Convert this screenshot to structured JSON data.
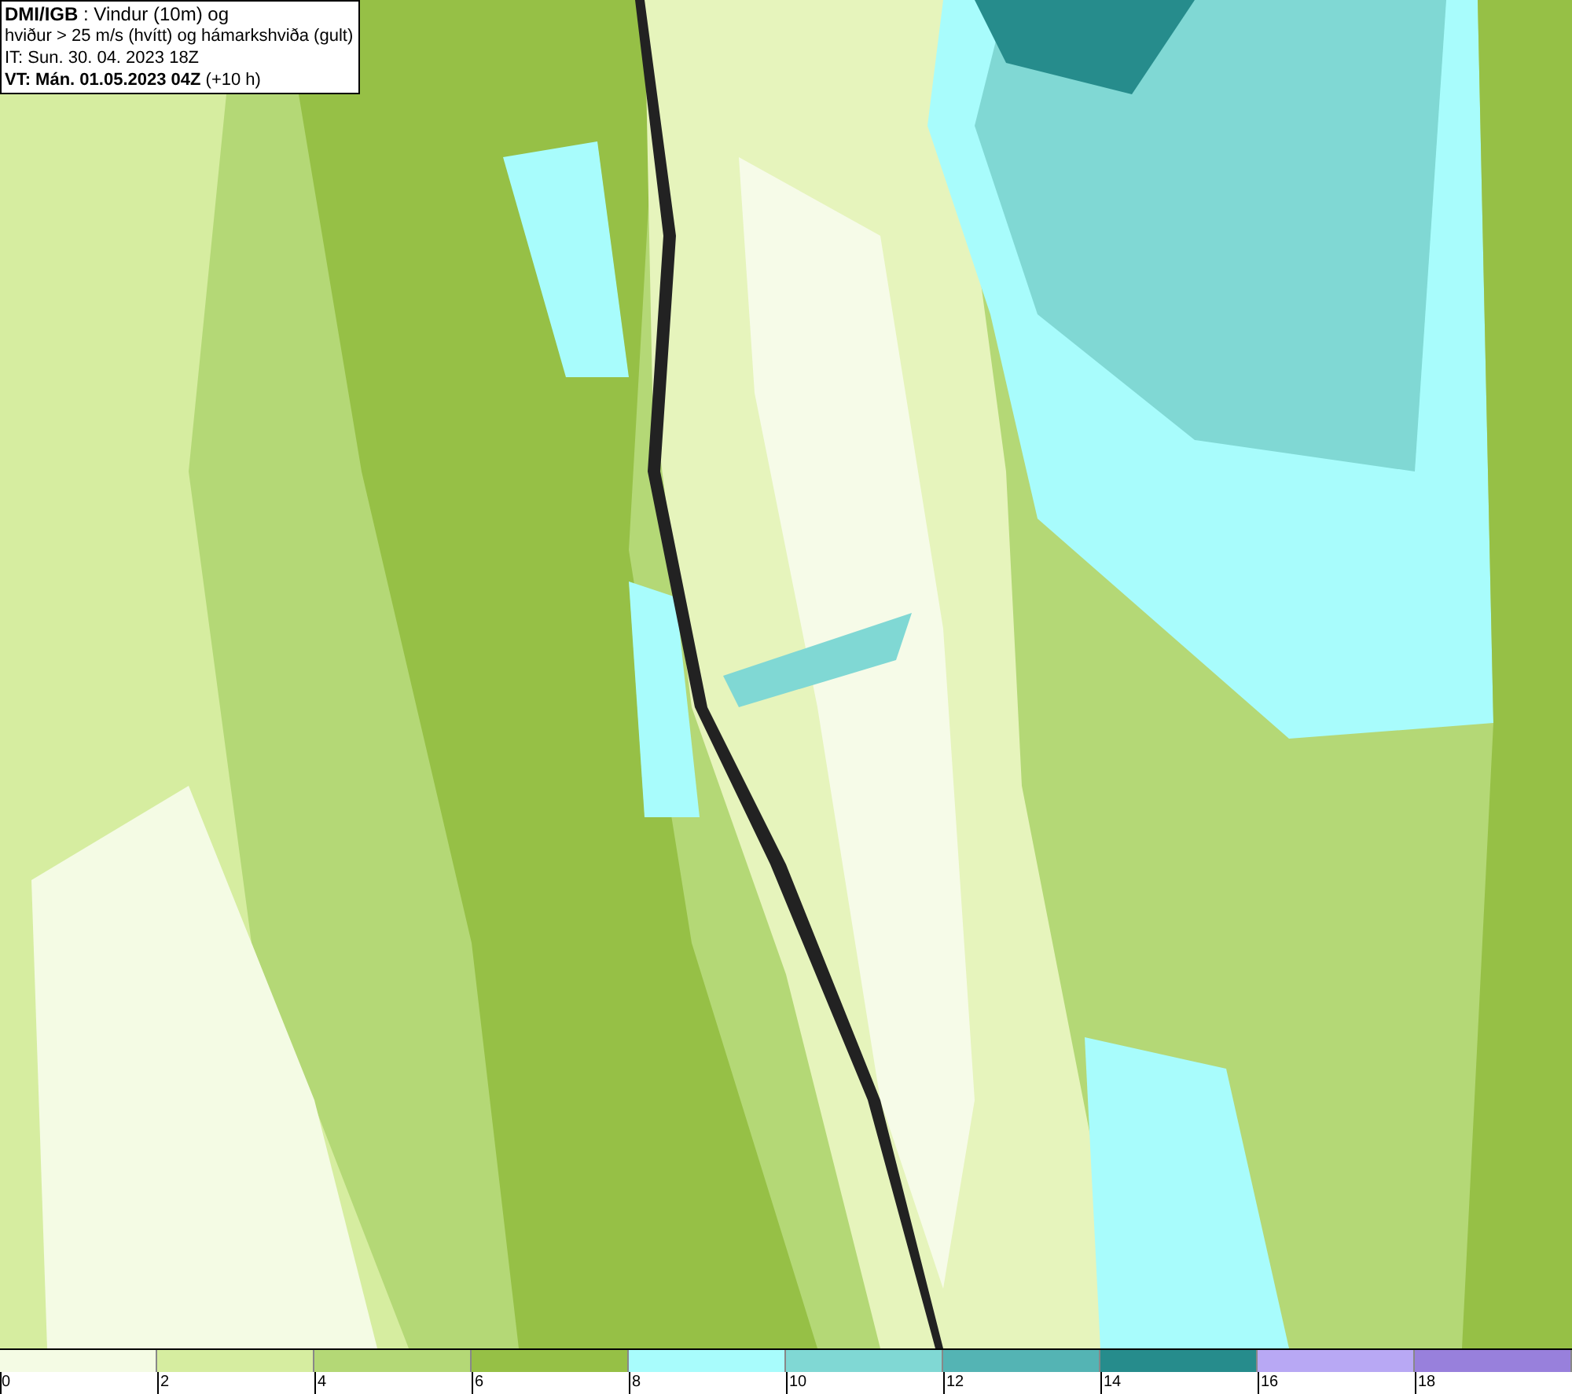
{
  "header": {
    "lines": [
      "**DMI/IGB** : Vindur (10m) og",
      "hviður > 25 m/s (hvítt) og hámarkshviða (gult)",
      "IT: Sun. 30. 04. 2023 18Z",
      "**VT: Mán. 01.05.2023 04Z** (+10 h)"
    ]
  },
  "legend": {
    "segments": [
      {
        "label": "0",
        "color": "#f4fbe4"
      },
      {
        "label": "2",
        "color": "#d6eda0"
      },
      {
        "label": "4",
        "color": "#b4d876"
      },
      {
        "label": "6",
        "color": "#96c046"
      },
      {
        "label": "8",
        "color": "#a8fcfc"
      },
      {
        "label": "10",
        "color": "#80d8d4"
      },
      {
        "label": "12",
        "color": "#54b4b4"
      },
      {
        "label": "14",
        "color": "#268c8c"
      },
      {
        "label": "16",
        "color": "#b8a8f4"
      },
      {
        "label": "18",
        "color": "#9880dc"
      }
    ]
  }
}
